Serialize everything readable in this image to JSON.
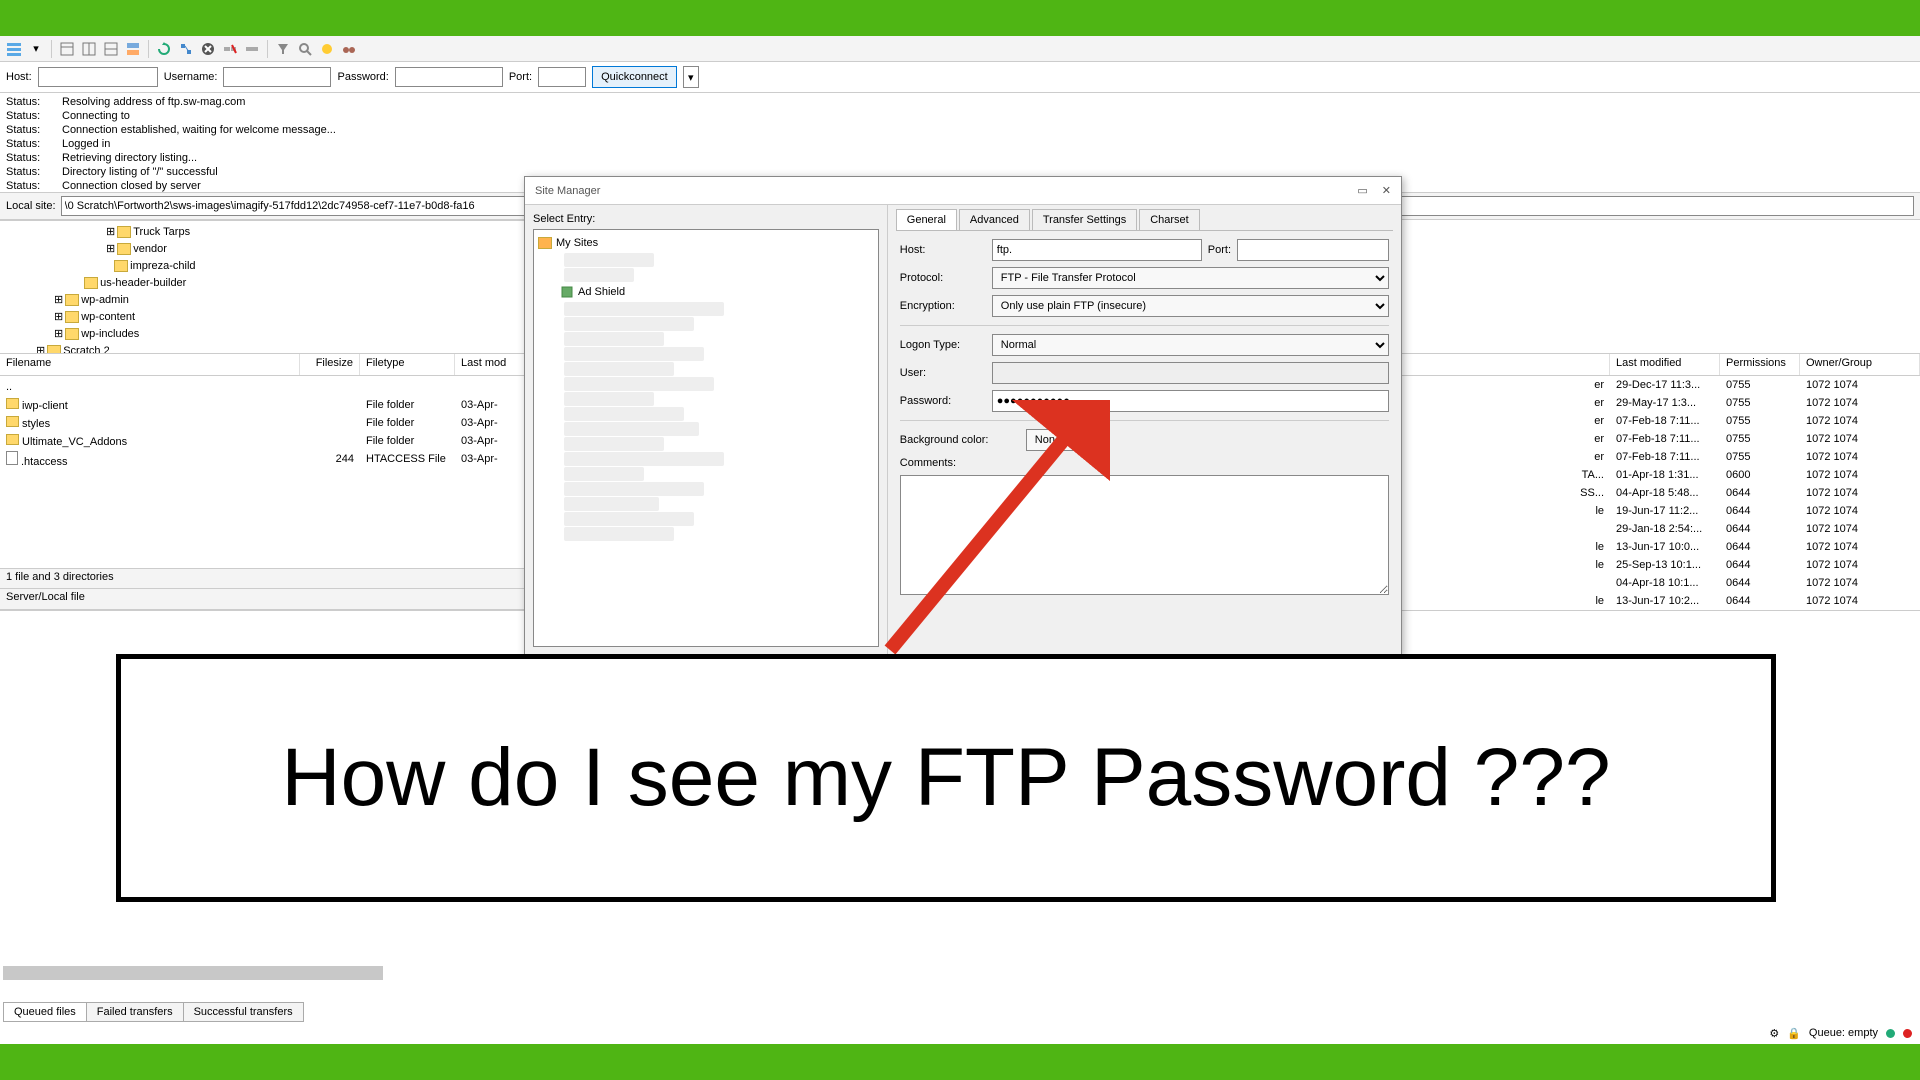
{
  "quickconnect": {
    "host_label": "Host:",
    "username_label": "Username:",
    "password_label": "Password:",
    "port_label": "Port:",
    "button": "Quickconnect"
  },
  "log": [
    {
      "label": "Status:",
      "msg": "Resolving address of ftp.sw-mag.com"
    },
    {
      "label": "Status:",
      "msg": "Connecting to"
    },
    {
      "label": "Status:",
      "msg": "Connection established, waiting for welcome message..."
    },
    {
      "label": "Status:",
      "msg": "Logged in"
    },
    {
      "label": "Status:",
      "msg": "Retrieving directory listing..."
    },
    {
      "label": "Status:",
      "msg": "Directory listing of \"/\" successful"
    },
    {
      "label": "Status:",
      "msg": "Connection closed by server"
    }
  ],
  "local_site": {
    "label": "Local site:",
    "path": "\\0 Scratch\\Fortworth2\\sws-images\\imagify-517fdd12\\2dc74958-cef7-11e7-b0d8-fa16"
  },
  "tree": [
    {
      "indent": 100,
      "name": "Truck Tarps"
    },
    {
      "indent": 100,
      "name": "vendor"
    },
    {
      "indent": 100,
      "name": "impreza-child"
    },
    {
      "indent": 70,
      "name": "us-header-builder"
    },
    {
      "indent": 70,
      "name": "wp-admin"
    },
    {
      "indent": 70,
      "name": "wp-content"
    },
    {
      "indent": 70,
      "name": "wp-includes"
    },
    {
      "indent": 50,
      "name": "Scratch 2"
    }
  ],
  "file_cols": {
    "filename": "Filename",
    "filesize": "Filesize",
    "filetype": "Filetype",
    "lastmod": "Last mod"
  },
  "files": [
    {
      "name": "..",
      "size": "",
      "type": "",
      "mod": ""
    },
    {
      "name": "iwp-client",
      "size": "",
      "type": "File folder",
      "mod": "03-Apr-"
    },
    {
      "name": "styles",
      "size": "",
      "type": "File folder",
      "mod": "03-Apr-"
    },
    {
      "name": "Ultimate_VC_Addons",
      "size": "",
      "type": "File folder",
      "mod": "03-Apr-"
    },
    {
      "name": ".htaccess",
      "size": "244",
      "type": "HTACCESS File",
      "mod": "03-Apr-"
    }
  ],
  "status_text": "1 file and 3 directories",
  "server_local": "Server/Local file",
  "remote_cols": {
    "filename": "Filename",
    "lastmod": "Last modified",
    "perms": "Permissions",
    "owner": "Owner/Group"
  },
  "remote_rows": [
    {
      "f": "er",
      "m": "29-Dec-17 11:3...",
      "p": "0755",
      "o": "1072 1074"
    },
    {
      "f": "er",
      "m": "29-May-17 1:3...",
      "p": "0755",
      "o": "1072 1074"
    },
    {
      "f": "er",
      "m": "07-Feb-18 7:11...",
      "p": "0755",
      "o": "1072 1074"
    },
    {
      "f": "er",
      "m": "07-Feb-18 7:11...",
      "p": "0755",
      "o": "1072 1074"
    },
    {
      "f": "er",
      "m": "07-Feb-18 7:11...",
      "p": "0755",
      "o": "1072 1074"
    },
    {
      "f": "TA...",
      "m": "01-Apr-18 1:31...",
      "p": "0600",
      "o": "1072 1074"
    },
    {
      "f": "SS...",
      "m": "04-Apr-18 5:48...",
      "p": "0644",
      "o": "1072 1074"
    },
    {
      "f": "le",
      "m": "19-Jun-17 11:2...",
      "p": "0644",
      "o": "1072 1074"
    },
    {
      "f": "",
      "m": "29-Jan-18 2:54:...",
      "p": "0644",
      "o": "1072 1074"
    },
    {
      "f": "le",
      "m": "13-Jun-17 10:0...",
      "p": "0644",
      "o": "1072 1074"
    },
    {
      "f": "le",
      "m": "25-Sep-13 10:1...",
      "p": "0644",
      "o": "1072 1074"
    },
    {
      "f": "",
      "m": "04-Apr-18 10:1...",
      "p": "0644",
      "o": "1072 1074"
    },
    {
      "f": "le",
      "m": "13-Jun-17 10:2...",
      "p": "0644",
      "o": "1072 1074"
    }
  ],
  "dialog": {
    "title": "Site Manager",
    "select_entry": "Select Entry:",
    "my_sites": "My Sites",
    "ad_shield": "Ad Shield",
    "tabs": {
      "general": "General",
      "advanced": "Advanced",
      "transfer": "Transfer Settings",
      "charset": "Charset"
    },
    "host_label": "Host:",
    "host_value": "ftp.",
    "port_label": "Port:",
    "protocol_label": "Protocol:",
    "protocol_value": "FTP - File Transfer Protocol",
    "encryption_label": "Encryption:",
    "encryption_value": "Only use plain FTP (insecure)",
    "logon_label": "Logon Type:",
    "logon_value": "Normal",
    "user_label": "User:",
    "password_label": "Password:",
    "password_value": "●●●●●●●●●●●",
    "bgcolor_label": "Background color:",
    "bgcolor_value": "None",
    "comments_label": "Comments:"
  },
  "bottom_tabs": {
    "queued": "Queued files",
    "failed": "Failed transfers",
    "success": "Successful transfers"
  },
  "queue_label": "Queue: empty",
  "overlay_text": "How do I see my FTP Password ???"
}
